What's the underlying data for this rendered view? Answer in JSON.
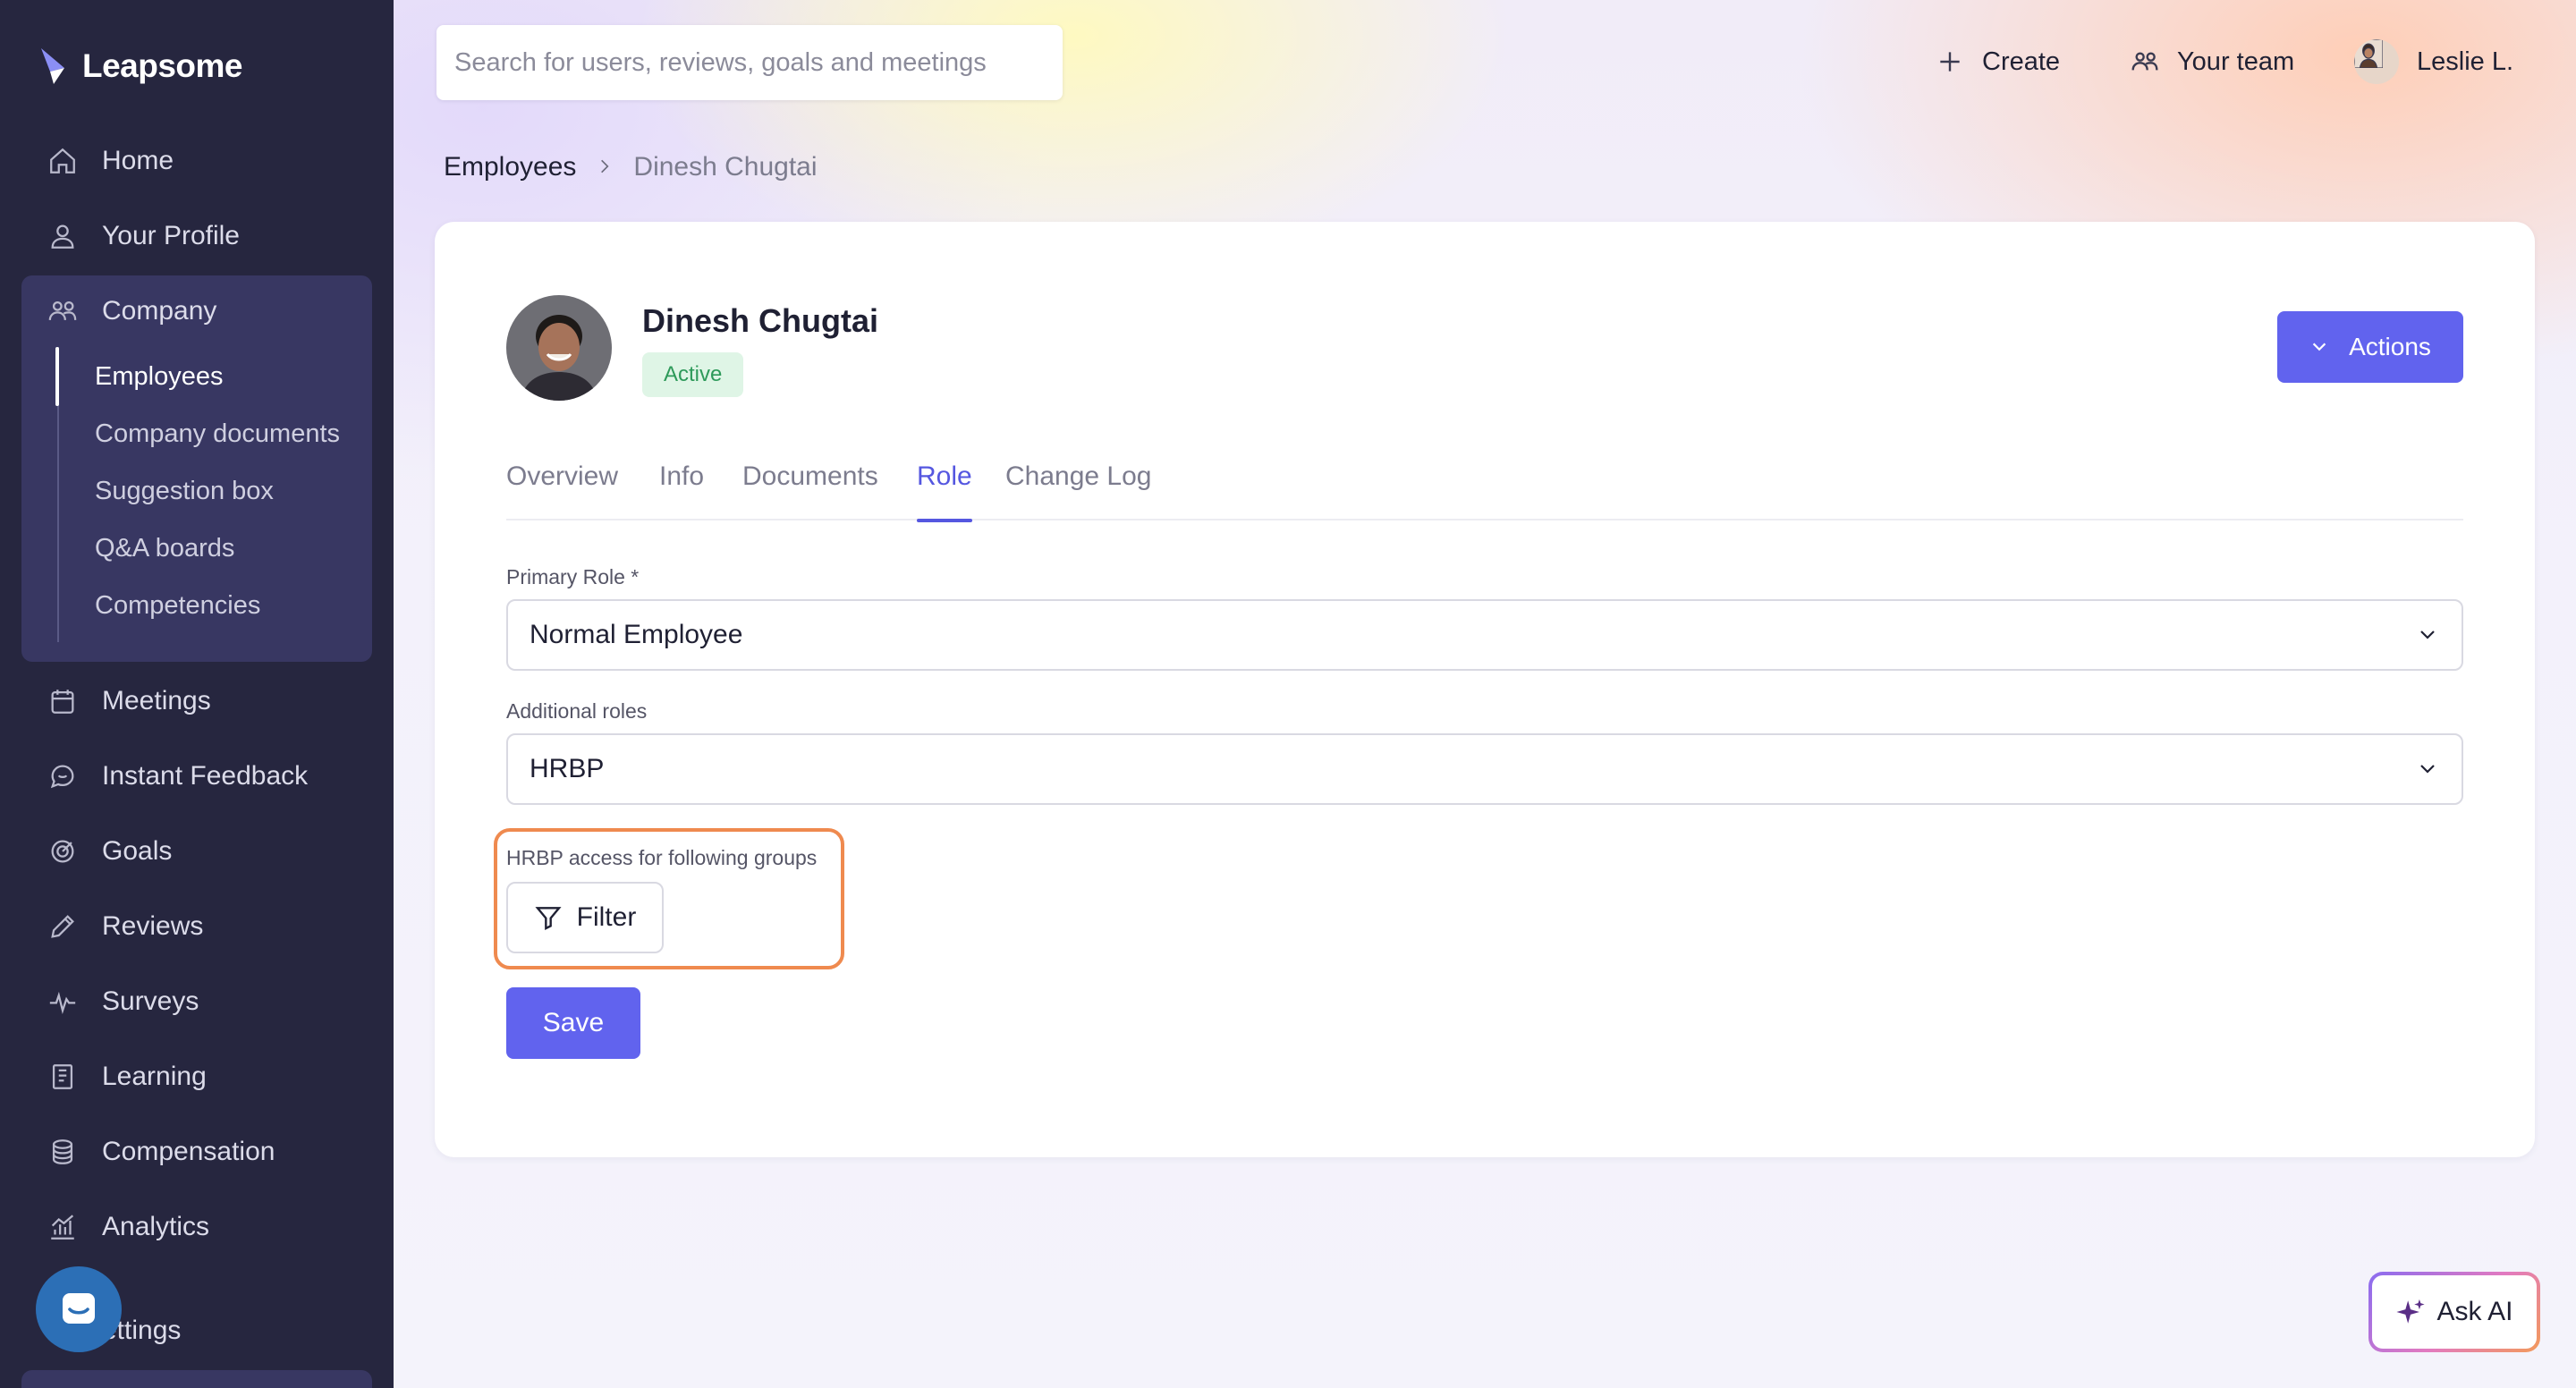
{
  "brand": {
    "name": "Leapsome"
  },
  "sidebar": {
    "items": [
      {
        "label": "Home",
        "icon": "home-icon"
      },
      {
        "label": "Your Profile",
        "icon": "user-icon"
      },
      {
        "label": "Company",
        "icon": "users-icon"
      },
      {
        "label": "Meetings",
        "icon": "calendar-icon"
      },
      {
        "label": "Instant Feedback",
        "icon": "chat-icon"
      },
      {
        "label": "Goals",
        "icon": "target-icon"
      },
      {
        "label": "Reviews",
        "icon": "pencil-icon"
      },
      {
        "label": "Surveys",
        "icon": "pulse-icon"
      },
      {
        "label": "Learning",
        "icon": "book-icon"
      },
      {
        "label": "Compensation",
        "icon": "coins-icon"
      },
      {
        "label": "Analytics",
        "icon": "chart-icon"
      },
      {
        "label": "ettings",
        "icon": "settings-icon"
      }
    ],
    "company_subitems": [
      {
        "label": "Employees",
        "active": true
      },
      {
        "label": "Company documents"
      },
      {
        "label": "Suggestion box"
      },
      {
        "label": "Q&A boards"
      },
      {
        "label": "Competencies"
      }
    ]
  },
  "topbar": {
    "search_placeholder": "Search for users, reviews, goals and meetings",
    "create_label": "Create",
    "your_team_label": "Your team",
    "user_name": "Leslie L."
  },
  "breadcrumb": {
    "parent": "Employees",
    "current": "Dinesh Chugtai"
  },
  "employee": {
    "name": "Dinesh Chugtai",
    "status": "Active"
  },
  "actions_label": "Actions",
  "tabs": [
    {
      "label": "Overview"
    },
    {
      "label": "Info"
    },
    {
      "label": "Documents"
    },
    {
      "label": "Role",
      "active": true
    },
    {
      "label": "Change Log"
    }
  ],
  "form": {
    "primary_role_label": "Primary Role *",
    "primary_role_value": "Normal Employee",
    "additional_roles_label": "Additional roles",
    "additional_roles_value": "HRBP",
    "hrbp_access_label": "HRBP access for following groups",
    "filter_label": "Filter",
    "save_label": "Save"
  },
  "ask_ai_label": "Ask AI",
  "colors": {
    "sidebar_bg": "#26263f",
    "accent": "#6163ee",
    "active_badge_bg": "#dff5e6",
    "active_badge_text": "#2e9a5a",
    "highlight_border": "#ef8a4f"
  }
}
